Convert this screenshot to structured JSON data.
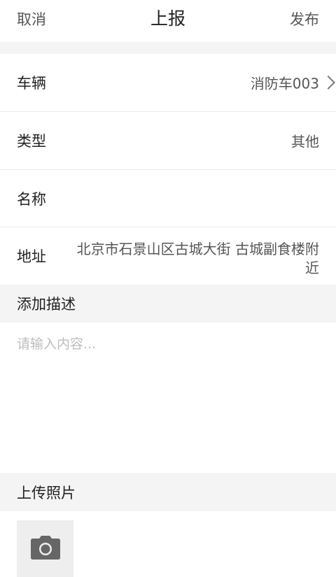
{
  "header": {
    "cancel_label": "取消",
    "title": "上报",
    "publish_label": "发布"
  },
  "form": {
    "vehicle": {
      "label": "车辆",
      "value": "消防车003"
    },
    "type": {
      "label": "类型",
      "value": "其他"
    },
    "name": {
      "label": "名称",
      "value": ""
    },
    "address": {
      "label": "地址",
      "value": "北京市石景山区古城大街 古城副食楼附近"
    }
  },
  "description": {
    "section_title": "添加描述",
    "placeholder": "请输入内容..."
  },
  "photos": {
    "section_title": "上传照片",
    "add_icon": "camera-icon"
  },
  "colors": {
    "section_bg": "#f4f4f4",
    "text_primary": "#222222",
    "text_secondary": "#555555",
    "placeholder": "#bdbdbd"
  }
}
